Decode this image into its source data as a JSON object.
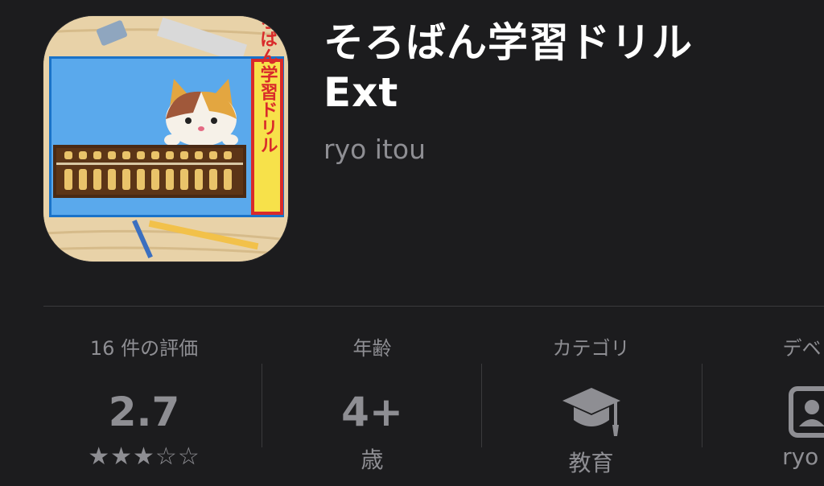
{
  "app": {
    "title_line1": "そろばん学習ドリル",
    "title_line2": "Ext",
    "developer": "ryo itou",
    "icon_banner": "そろばん学習ドリル"
  },
  "info": {
    "ratings": {
      "label": "16 件の評価",
      "value": "2.7",
      "stars": "★★★☆☆",
      "rating_out_of_5": 2.7
    },
    "age": {
      "label": "年齢",
      "value": "4+",
      "unit": "歳"
    },
    "category": {
      "label": "カテゴリ",
      "icon": "graduation-cap-icon",
      "value": "教育"
    },
    "developer": {
      "label": "デベロ",
      "icon": "person-icon",
      "value": "ryo it"
    }
  },
  "colors": {
    "background": "#1c1c1e",
    "secondary_text": "#8e8e93",
    "divider": "#3a3a3c"
  }
}
